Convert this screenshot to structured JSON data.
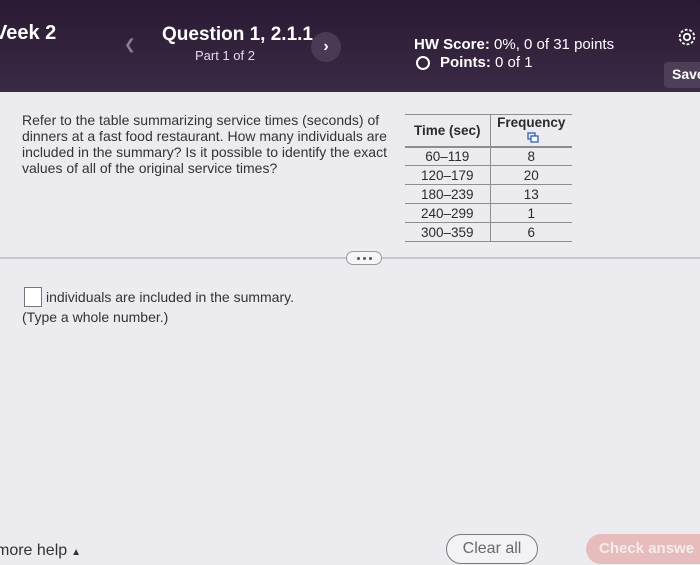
{
  "header": {
    "week": "Veek 2",
    "question_title": "Question 1, 2.1.1",
    "question_part": "Part 1 of 2",
    "hw_score_label": "HW Score:",
    "hw_score_value": "0%, 0 of 31 points",
    "points_label": "Points:",
    "points_value": "0 of 1",
    "save_label": "Save",
    "prev_icon": "chevron-left-icon",
    "next_icon": "chevron-right-icon",
    "settings_icon": "gear-icon"
  },
  "question": {
    "text": "Refer to the table summarizing service times (seconds) of dinners at a fast food restaurant. How many individuals are included in the summary? Is it possible to identify the exact values of all of the original service times?"
  },
  "table": {
    "headers": [
      "Time (sec)",
      "Frequency"
    ],
    "rows": [
      [
        "60–119",
        "8"
      ],
      [
        "120–179",
        "20"
      ],
      [
        "180–239",
        "13"
      ],
      [
        "240–299",
        "1"
      ],
      [
        "300–359",
        "6"
      ]
    ]
  },
  "answer": {
    "value": "",
    "suffix": "individuals are included in the summary.",
    "hint": "(Type a whole number.)"
  },
  "footer": {
    "more_help": "more help",
    "clear_all": "Clear all",
    "check_answer": "Check answe"
  }
}
